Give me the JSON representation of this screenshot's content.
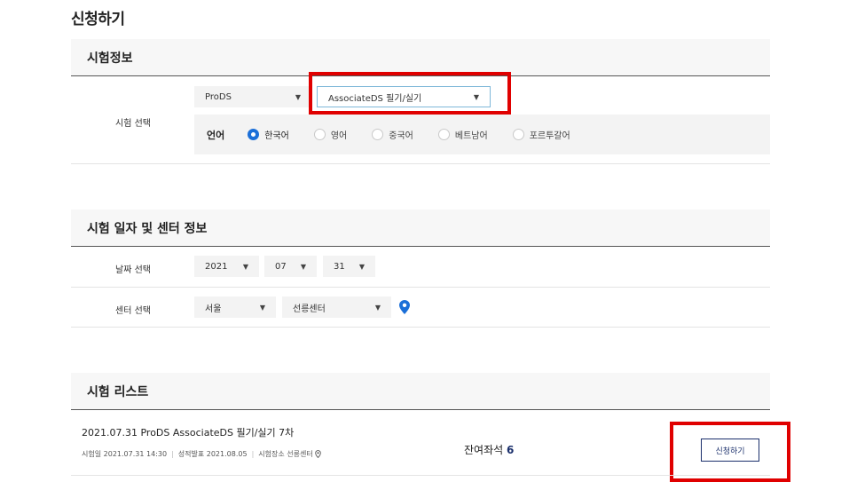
{
  "page": {
    "title": "신청하기"
  },
  "exam_info": {
    "header": "시험정보",
    "select_label": "시험 선택",
    "exam_type": "ProDS",
    "exam_subtype": "AssociateDS 필기/실기",
    "language_label": "언어",
    "languages": [
      {
        "label": "한국어",
        "checked": true
      },
      {
        "label": "영어",
        "checked": false
      },
      {
        "label": "중국어",
        "checked": false
      },
      {
        "label": "베트남어",
        "checked": false
      },
      {
        "label": "포르투갈어",
        "checked": false
      }
    ]
  },
  "schedule": {
    "header": "시험 일자 및 센터 정보",
    "date_label": "날짜 선택",
    "year": "2021",
    "month": "07",
    "day": "31",
    "center_label": "센터 선택",
    "region": "서울",
    "center": "선릉센터",
    "icon": "map-pin-icon"
  },
  "exam_list": {
    "header": "시험 리스트",
    "items": [
      {
        "title": "2021.07.31 ProDS AssociateDS 필기/실기 7차",
        "exam_date_label": "시험일",
        "exam_date": "2021.07.31 14:30",
        "result_label": "성적발표",
        "result_date": "2021.08.05",
        "place_label": "시험장소",
        "place": "선릉센터",
        "seats_label": "잔여좌석",
        "seats": "6",
        "apply_label": "신청하기"
      }
    ]
  },
  "colors": {
    "accent": "#1b6fd8",
    "navy": "#1a2f6b",
    "highlight": "#e00000"
  }
}
